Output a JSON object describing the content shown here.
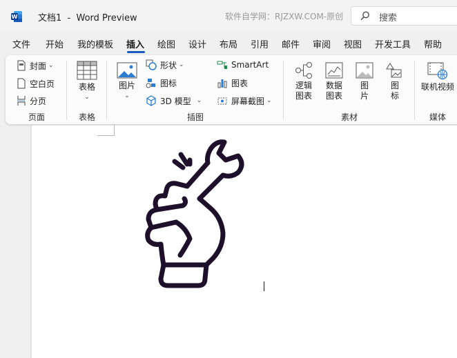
{
  "window": {
    "doc_name": "文档1",
    "separator": "-",
    "app_name": "Word Preview",
    "watermark": "软件自学网：RJZXW.COM-原创",
    "search_placeholder": "搜索"
  },
  "tabs": [
    "文件",
    "开始",
    "我的模板",
    "插入",
    "绘图",
    "设计",
    "布局",
    "引用",
    "邮件",
    "审阅",
    "视图",
    "开发工具",
    "帮助"
  ],
  "active_tab": "插入",
  "ribbon": {
    "pages_group": {
      "label": "页面",
      "cover": "封面",
      "blank_page": "空白页",
      "page_break": "分页"
    },
    "table_group": {
      "label": "表格",
      "table": "表格"
    },
    "illustrations_group": {
      "label": "插图",
      "pictures": "图片",
      "shapes": "形状",
      "icons": "图标",
      "models_3d": "3D 模型",
      "smartart": "SmartArt",
      "chart": "图表",
      "screenshot": "屏幕截图"
    },
    "assets_group": {
      "label": "素材",
      "logic_chart": [
        "逻辑",
        "图表"
      ],
      "data_chart": [
        "数据",
        "图表"
      ],
      "picture": [
        "图",
        "片"
      ],
      "icon": [
        "图",
        "标"
      ]
    },
    "media_group": {
      "label": "媒体",
      "online_video": "联机视频"
    }
  },
  "colors": {
    "accent": "#185abd",
    "icon_ink": "#1e0f2b"
  }
}
